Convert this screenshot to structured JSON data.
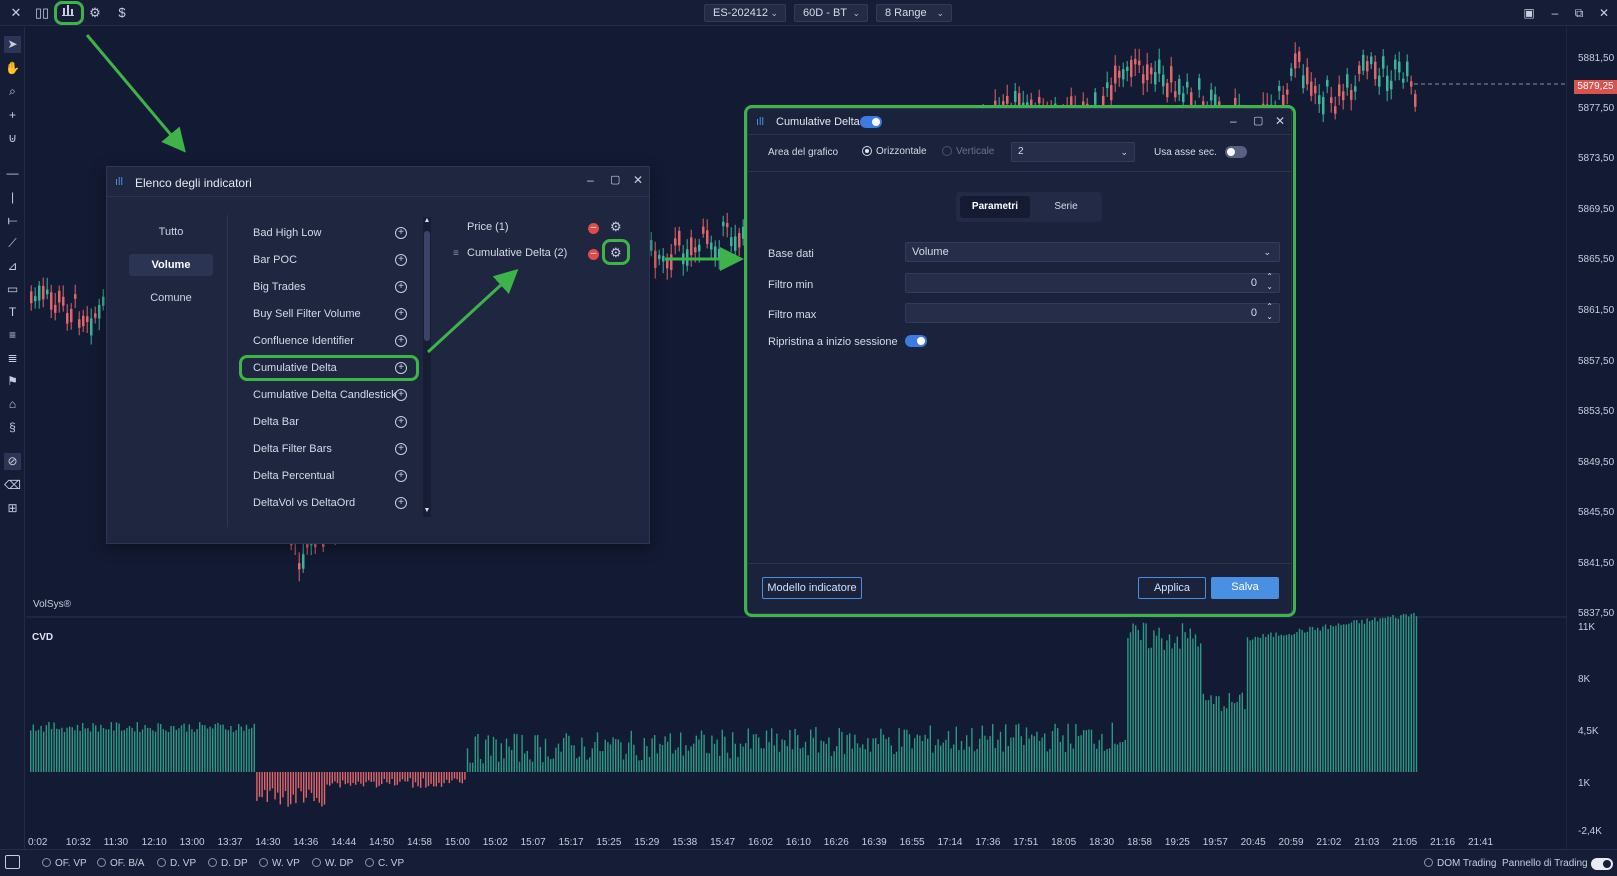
{
  "topbar": {
    "close_icon": "x-icon",
    "dropdowns": [
      "ES-202412",
      "60D - BT",
      "8 Range"
    ],
    "currency_symbol": "$"
  },
  "price_axis": {
    "labels": [
      "5881,50",
      "5877,50",
      "5873,50",
      "5869,50",
      "5865,50",
      "5861,50",
      "5857,50",
      "5853,50",
      "5849,50",
      "5845,50",
      "5841,50",
      "5837,50"
    ],
    "current_price": "5879,25",
    "cvd_labels": [
      "11K",
      "8K",
      "4,5K",
      "1K",
      "-2,4K"
    ]
  },
  "time_axis": [
    "0:02",
    "10:32",
    "11:30",
    "12:10",
    "13:00",
    "13:37",
    "14:30",
    "14:36",
    "14:44",
    "14:50",
    "14:58",
    "15:00",
    "15:02",
    "15:07",
    "15:17",
    "15:25",
    "15:29",
    "15:38",
    "15:47",
    "16:02",
    "16:10",
    "16:26",
    "16:39",
    "16:55",
    "17:14",
    "17:36",
    "17:51",
    "18:05",
    "18:30",
    "18:58",
    "19:25",
    "19:57",
    "20:45",
    "20:59",
    "21:02",
    "21:03",
    "21:05",
    "21:16",
    "21:41"
  ],
  "chart": {
    "watermark": "VolSys®",
    "cvd_label": "CVD"
  },
  "bottombar": {
    "radios": [
      "OF. VP",
      "OF. B/A",
      "D. VP",
      "D. DP",
      "W. VP",
      "W. DP",
      "C. VP"
    ],
    "dom_trading": "DOM Trading",
    "trading_panel": "Pannello di Trading"
  },
  "indicator_list": {
    "title": "Elenco degli indicatori",
    "categories": [
      "Tutto",
      "Volume",
      "Comune"
    ],
    "indicators": [
      "Bad High Low",
      "Bar POC",
      "Big Trades",
      "Buy Sell Filter Volume",
      "Confluence Identifier",
      "Cumulative Delta",
      "Cumulative Delta Candlestick",
      "Delta Bar",
      "Delta Filter Bars",
      "Delta Percentual",
      "DeltaVol vs DeltaOrd"
    ],
    "active": [
      "Price (1)",
      "Cumulative Delta (2)"
    ]
  },
  "cd_dialog": {
    "title": "Cumulative Delta",
    "chart_area_label": "Area del grafico",
    "horizontal": "Orizzontale",
    "vertical": "Verticale",
    "panel_number": "2",
    "secondary_axis": "Usa asse sec.",
    "tabs": [
      "Parametri",
      "Serie"
    ],
    "base_label": "Base dati",
    "base_value": "Volume",
    "filter_min_label": "Filtro min",
    "filter_min_value": "0",
    "filter_max_label": "Filtro max",
    "filter_max_value": "0",
    "reset_label": "Ripristina a inizio sessione",
    "model_button": "Modello indicatore",
    "apply_button": "Applica",
    "save_button": "Salva"
  },
  "colors": {
    "background": "#131a33",
    "bull": "#3bb59a",
    "bear": "#e0666a",
    "cvd": "#2a9a84",
    "highlight": "#3db34a",
    "accent": "#4a90e2"
  }
}
